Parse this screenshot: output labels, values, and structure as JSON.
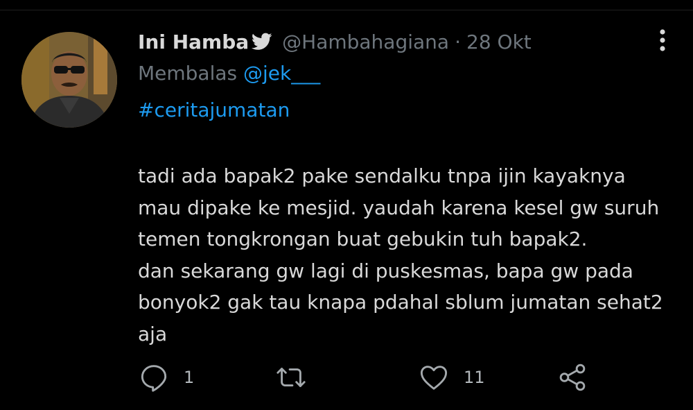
{
  "tweet": {
    "display_name": "Ini Hamba",
    "handle": "@Hambahagiana",
    "separator": "·",
    "date": "28 Okt",
    "reply_prefix": "Membalas",
    "reply_to": "@jek___",
    "hashtag": "#ceritajumatan",
    "body_lines": [
      "tadi ada bapak2 pake sendalku tnpa ijin kayaknya",
      "mau dipake ke mesjid. yaudah karena kesel gw suruh",
      "temen tongkrongan buat gebukin tuh bapak2.",
      "dan sekarang gw lagi di puskesmas, bapa gw pada",
      "bonyok2 gak tau knapa pdahal sblum jumatan sehat2",
      "aja"
    ]
  },
  "actions": {
    "reply_count": "1",
    "retweet_count": "",
    "like_count": "11"
  },
  "colors": {
    "background": "#000000",
    "text": "#d9d9d9",
    "secondary": "#6e767d",
    "link": "#1d9bf0"
  },
  "icons": {
    "bird": "twitter-bird-icon",
    "more": "more-vertical-icon",
    "reply": "reply-icon",
    "retweet": "retweet-icon",
    "like": "heart-icon",
    "share": "share-icon"
  }
}
